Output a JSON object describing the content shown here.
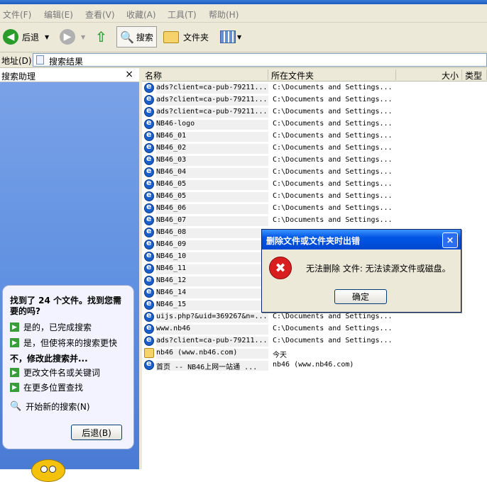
{
  "menu": [
    "文件(F)",
    "编辑(E)",
    "查看(V)",
    "收藏(A)",
    "工具(T)",
    "帮助(H)"
  ],
  "toolbar": {
    "back": "后退",
    "search": "搜索",
    "folders": "文件夹"
  },
  "address": {
    "label": "地址(D)",
    "value": "搜索结果"
  },
  "left_pane": {
    "title": "搜索助理",
    "close": "×",
    "found": "找到了 24 个文件。找到您需要的吗?",
    "options_yes": [
      "是的，已完成搜索",
      "是，但使将来的搜索更快"
    ],
    "no_header": "不，修改此搜索并...",
    "options_no": [
      "更改文件名或关键词",
      "在更多位置查找"
    ],
    "new_search": "开始新的搜索(N)",
    "back_button": "后退(B)"
  },
  "columns": [
    "名称",
    "所在文件夹",
    "大小",
    "类型"
  ],
  "rows": [
    {
      "name": "ads?client=ca-pub-79211...",
      "folder": "C:\\Documents and Settings..."
    },
    {
      "name": "ads?client=ca-pub-79211...",
      "folder": "C:\\Documents and Settings..."
    },
    {
      "name": "ads?client=ca-pub-79211...",
      "folder": "C:\\Documents and Settings..."
    },
    {
      "name": "NB46-logo",
      "folder": "C:\\Documents and Settings..."
    },
    {
      "name": "NB46_01",
      "folder": "C:\\Documents and Settings..."
    },
    {
      "name": "NB46_02",
      "folder": "C:\\Documents and Settings..."
    },
    {
      "name": "NB46_03",
      "folder": "C:\\Documents and Settings..."
    },
    {
      "name": "NB46_04",
      "folder": "C:\\Documents and Settings..."
    },
    {
      "name": "NB46_05",
      "folder": "C:\\Documents and Settings..."
    },
    {
      "name": "NB46_05",
      "folder": "C:\\Documents and Settings..."
    },
    {
      "name": "NB46_06",
      "folder": "C:\\Documents and Settings..."
    },
    {
      "name": "NB46_07",
      "folder": "C:\\Documents and Settings..."
    },
    {
      "name": "NB46_08",
      "folder": ""
    },
    {
      "name": "NB46_09",
      "folder": ""
    },
    {
      "name": "NB46_10",
      "folder": ""
    },
    {
      "name": "NB46_11",
      "folder": ""
    },
    {
      "name": "NB46_12",
      "folder": ""
    },
    {
      "name": "NB46_14",
      "folder": ""
    },
    {
      "name": "NB46_15",
      "folder": ""
    },
    {
      "name": "uijs.php?&uid=369267&n=...",
      "folder": "C:\\Documents and Settings..."
    },
    {
      "name": "www.nb46",
      "folder": "C:\\Documents and Settings..."
    },
    {
      "name": "ads?client=ca-pub-79211...",
      "folder": "C:\\Documents and Settings..."
    },
    {
      "name": "nb46 (www.nb46.com)",
      "folder": "今天"
    },
    {
      "name": "首页 -- NB46上网一站通 ...",
      "folder": "nb46 (www.nb46.com)"
    }
  ],
  "dialog": {
    "title": "删除文件或文件夹时出错",
    "message": "无法删除 文件: 无法读源文件或磁盘。",
    "ok": "确定",
    "close": "×"
  }
}
